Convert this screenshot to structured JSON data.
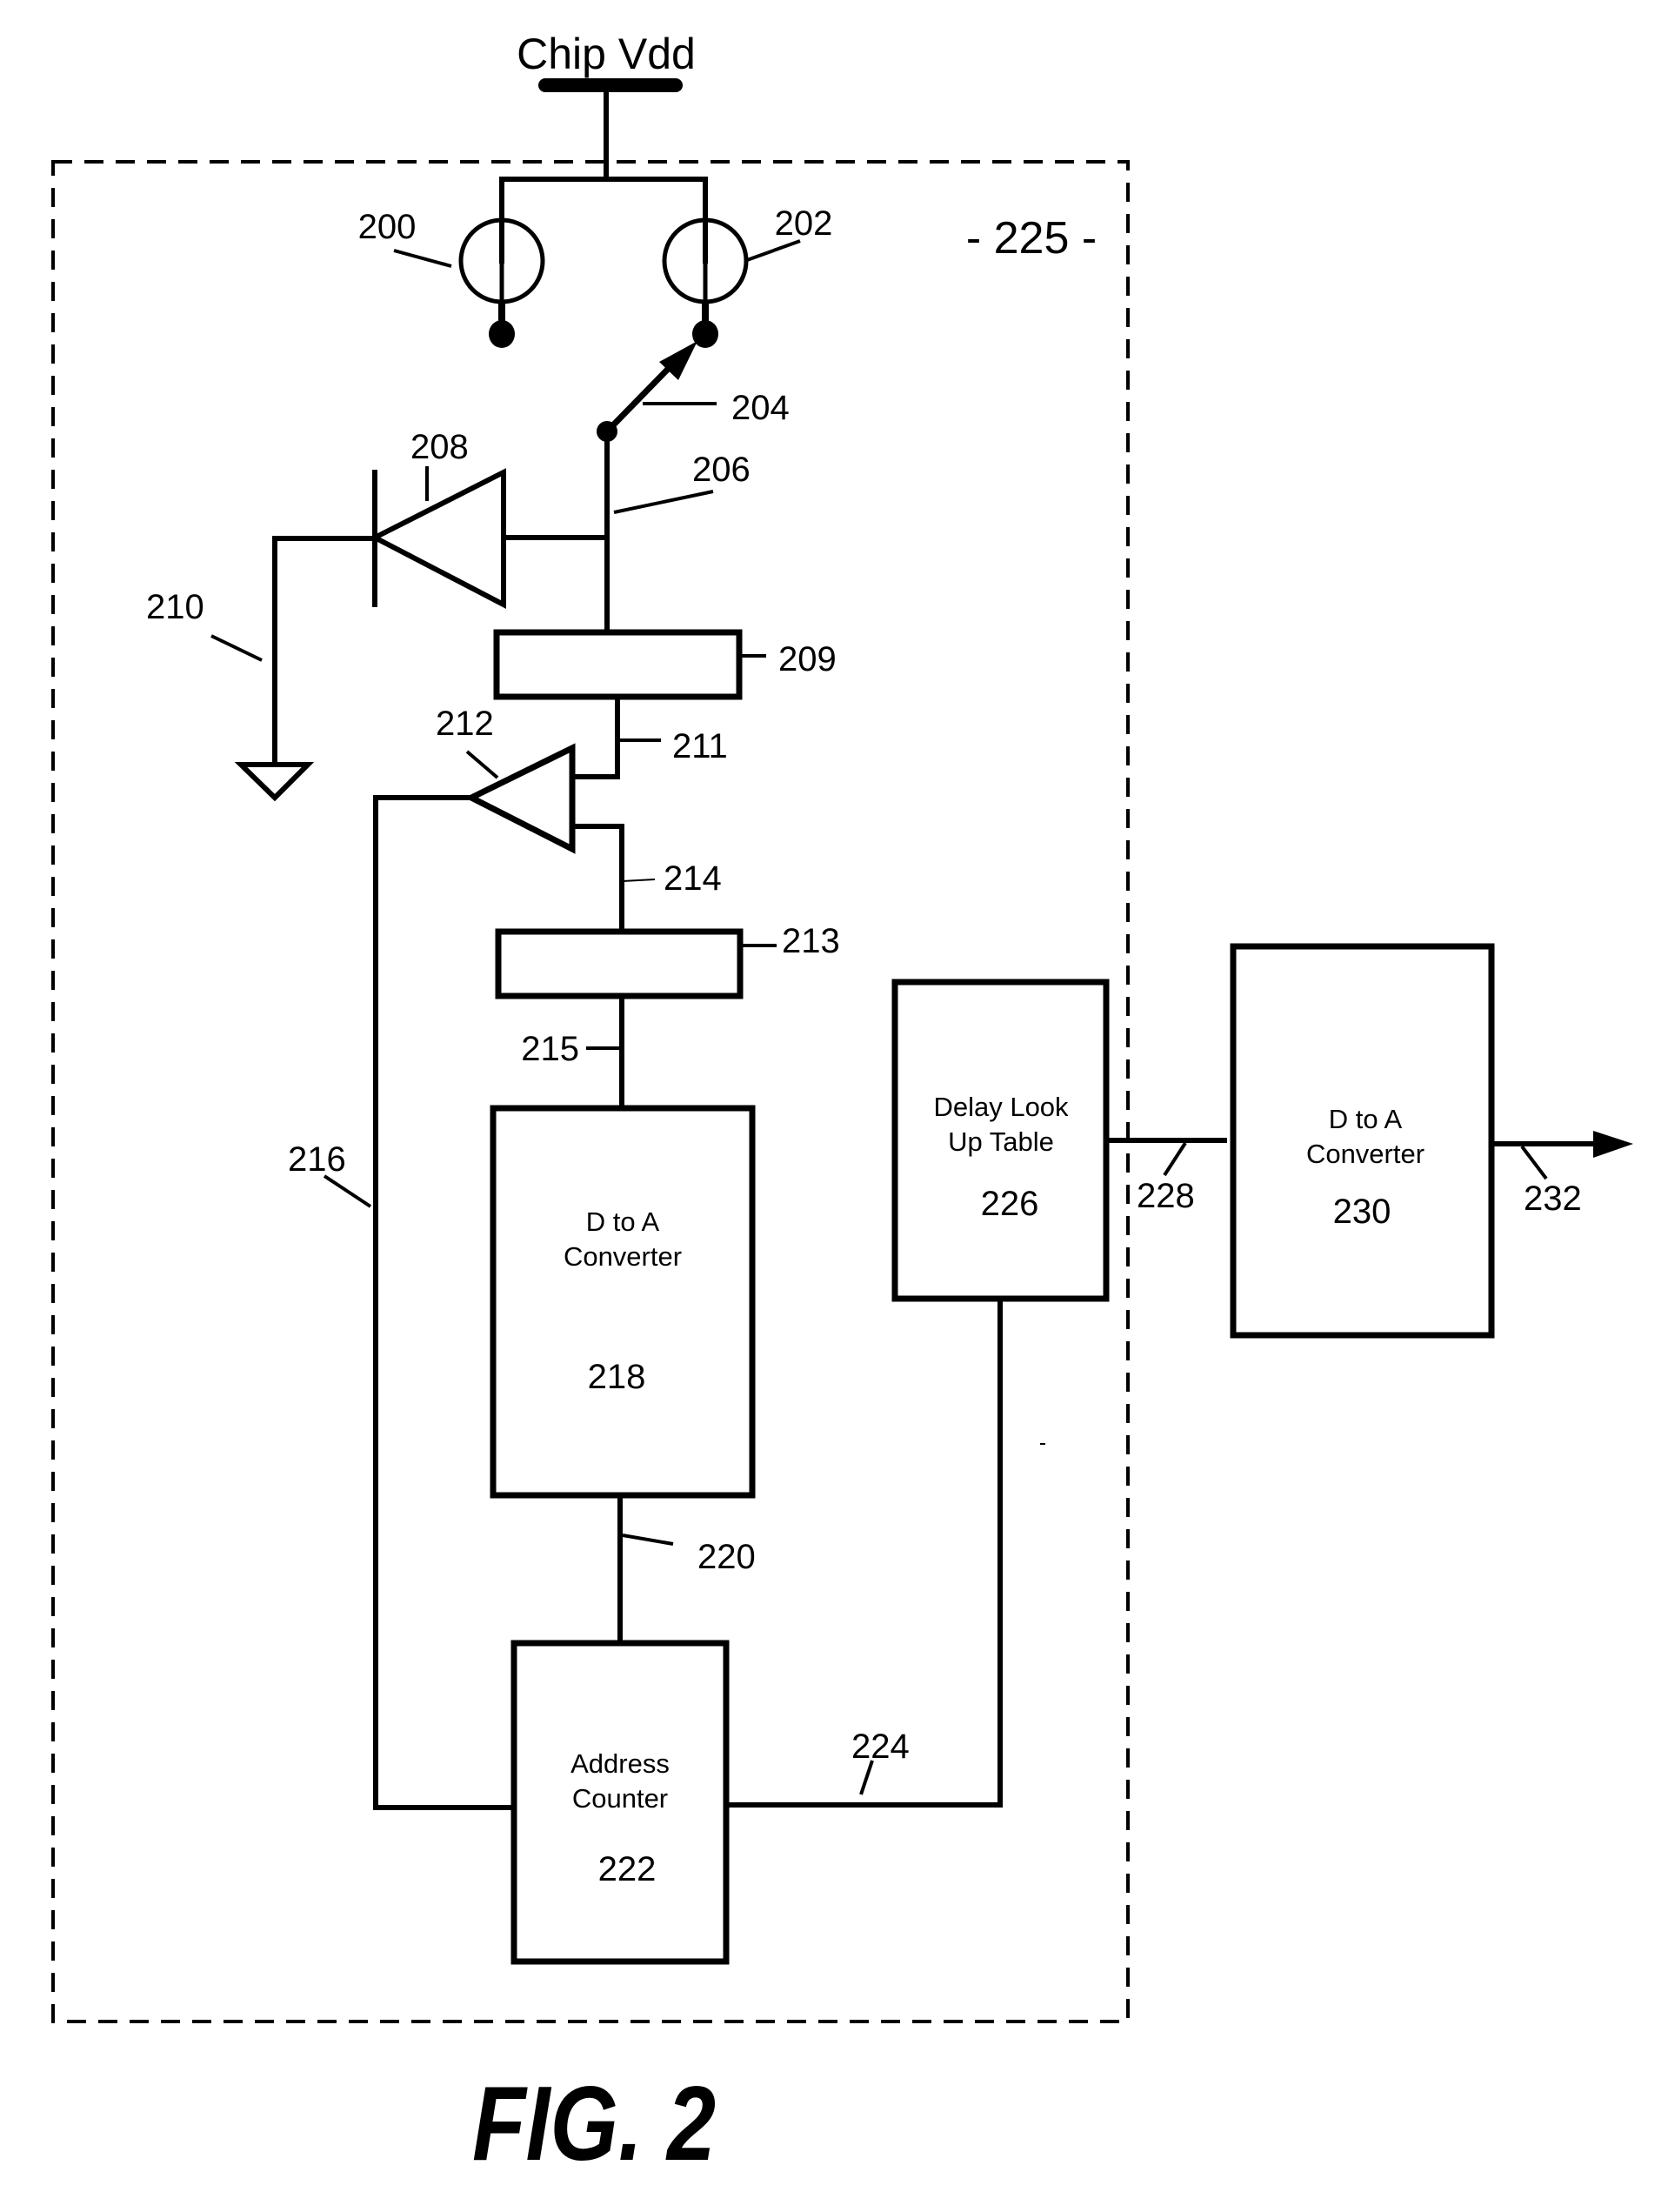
{
  "figure": {
    "caption": "FIG. 2",
    "supply_label": "Chip Vdd",
    "enclosure_label": "- 225 -"
  },
  "components": {
    "current_source_a": {
      "ref": "200"
    },
    "current_source_b": {
      "ref": "202"
    },
    "switch": {
      "ref": "204"
    },
    "node": {
      "ref": "206"
    },
    "diode": {
      "ref": "208"
    },
    "block_209": {
      "ref": "209"
    },
    "ground": {
      "ref": "210"
    },
    "line_211": {
      "ref": "211"
    },
    "amplifier": {
      "ref": "212"
    },
    "block_213": {
      "ref": "213"
    },
    "line_214": {
      "ref": "214"
    },
    "line_215": {
      "ref": "215"
    },
    "feedback_line": {
      "ref": "216"
    },
    "dac_218": {
      "line1": "D to A",
      "line2": "Converter",
      "ref": "218"
    },
    "line_220": {
      "ref": "220"
    },
    "address_counter": {
      "line1": "Address",
      "line2": "Counter",
      "ref": "222"
    },
    "line_224": {
      "ref": "224"
    },
    "delay_lut": {
      "line1": "Delay Look",
      "line2": "Up Table",
      "ref": "226"
    },
    "line_228": {
      "ref": "228"
    },
    "dac_230": {
      "line1": "D to A",
      "line2": "Converter",
      "ref": "230"
    },
    "output_line": {
      "ref": "232"
    }
  }
}
